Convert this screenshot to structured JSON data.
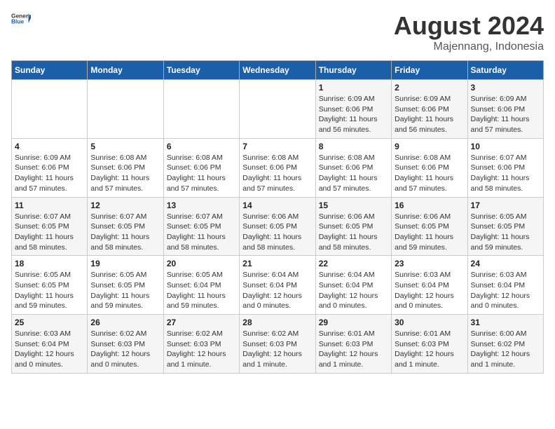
{
  "header": {
    "logo_general": "General",
    "logo_blue": "Blue",
    "title": "August 2024",
    "subtitle": "Majennang, Indonesia"
  },
  "weekdays": [
    "Sunday",
    "Monday",
    "Tuesday",
    "Wednesday",
    "Thursday",
    "Friday",
    "Saturday"
  ],
  "weeks": [
    [
      {
        "day": "",
        "info": ""
      },
      {
        "day": "",
        "info": ""
      },
      {
        "day": "",
        "info": ""
      },
      {
        "day": "",
        "info": ""
      },
      {
        "day": "1",
        "info": "Sunrise: 6:09 AM\nSunset: 6:06 PM\nDaylight: 11 hours\nand 56 minutes."
      },
      {
        "day": "2",
        "info": "Sunrise: 6:09 AM\nSunset: 6:06 PM\nDaylight: 11 hours\nand 56 minutes."
      },
      {
        "day": "3",
        "info": "Sunrise: 6:09 AM\nSunset: 6:06 PM\nDaylight: 11 hours\nand 57 minutes."
      }
    ],
    [
      {
        "day": "4",
        "info": "Sunrise: 6:09 AM\nSunset: 6:06 PM\nDaylight: 11 hours\nand 57 minutes."
      },
      {
        "day": "5",
        "info": "Sunrise: 6:08 AM\nSunset: 6:06 PM\nDaylight: 11 hours\nand 57 minutes."
      },
      {
        "day": "6",
        "info": "Sunrise: 6:08 AM\nSunset: 6:06 PM\nDaylight: 11 hours\nand 57 minutes."
      },
      {
        "day": "7",
        "info": "Sunrise: 6:08 AM\nSunset: 6:06 PM\nDaylight: 11 hours\nand 57 minutes."
      },
      {
        "day": "8",
        "info": "Sunrise: 6:08 AM\nSunset: 6:06 PM\nDaylight: 11 hours\nand 57 minutes."
      },
      {
        "day": "9",
        "info": "Sunrise: 6:08 AM\nSunset: 6:06 PM\nDaylight: 11 hours\nand 57 minutes."
      },
      {
        "day": "10",
        "info": "Sunrise: 6:07 AM\nSunset: 6:06 PM\nDaylight: 11 hours\nand 58 minutes."
      }
    ],
    [
      {
        "day": "11",
        "info": "Sunrise: 6:07 AM\nSunset: 6:05 PM\nDaylight: 11 hours\nand 58 minutes."
      },
      {
        "day": "12",
        "info": "Sunrise: 6:07 AM\nSunset: 6:05 PM\nDaylight: 11 hours\nand 58 minutes."
      },
      {
        "day": "13",
        "info": "Sunrise: 6:07 AM\nSunset: 6:05 PM\nDaylight: 11 hours\nand 58 minutes."
      },
      {
        "day": "14",
        "info": "Sunrise: 6:06 AM\nSunset: 6:05 PM\nDaylight: 11 hours\nand 58 minutes."
      },
      {
        "day": "15",
        "info": "Sunrise: 6:06 AM\nSunset: 6:05 PM\nDaylight: 11 hours\nand 58 minutes."
      },
      {
        "day": "16",
        "info": "Sunrise: 6:06 AM\nSunset: 6:05 PM\nDaylight: 11 hours\nand 59 minutes."
      },
      {
        "day": "17",
        "info": "Sunrise: 6:05 AM\nSunset: 6:05 PM\nDaylight: 11 hours\nand 59 minutes."
      }
    ],
    [
      {
        "day": "18",
        "info": "Sunrise: 6:05 AM\nSunset: 6:05 PM\nDaylight: 11 hours\nand 59 minutes."
      },
      {
        "day": "19",
        "info": "Sunrise: 6:05 AM\nSunset: 6:05 PM\nDaylight: 11 hours\nand 59 minutes."
      },
      {
        "day": "20",
        "info": "Sunrise: 6:05 AM\nSunset: 6:04 PM\nDaylight: 11 hours\nand 59 minutes."
      },
      {
        "day": "21",
        "info": "Sunrise: 6:04 AM\nSunset: 6:04 PM\nDaylight: 12 hours\nand 0 minutes."
      },
      {
        "day": "22",
        "info": "Sunrise: 6:04 AM\nSunset: 6:04 PM\nDaylight: 12 hours\nand 0 minutes."
      },
      {
        "day": "23",
        "info": "Sunrise: 6:03 AM\nSunset: 6:04 PM\nDaylight: 12 hours\nand 0 minutes."
      },
      {
        "day": "24",
        "info": "Sunrise: 6:03 AM\nSunset: 6:04 PM\nDaylight: 12 hours\nand 0 minutes."
      }
    ],
    [
      {
        "day": "25",
        "info": "Sunrise: 6:03 AM\nSunset: 6:04 PM\nDaylight: 12 hours\nand 0 minutes."
      },
      {
        "day": "26",
        "info": "Sunrise: 6:02 AM\nSunset: 6:03 PM\nDaylight: 12 hours\nand 0 minutes."
      },
      {
        "day": "27",
        "info": "Sunrise: 6:02 AM\nSunset: 6:03 PM\nDaylight: 12 hours\nand 1 minute."
      },
      {
        "day": "28",
        "info": "Sunrise: 6:02 AM\nSunset: 6:03 PM\nDaylight: 12 hours\nand 1 minute."
      },
      {
        "day": "29",
        "info": "Sunrise: 6:01 AM\nSunset: 6:03 PM\nDaylight: 12 hours\nand 1 minute."
      },
      {
        "day": "30",
        "info": "Sunrise: 6:01 AM\nSunset: 6:03 PM\nDaylight: 12 hours\nand 1 minute."
      },
      {
        "day": "31",
        "info": "Sunrise: 6:00 AM\nSunset: 6:02 PM\nDaylight: 12 hours\nand 1 minute."
      }
    ]
  ]
}
